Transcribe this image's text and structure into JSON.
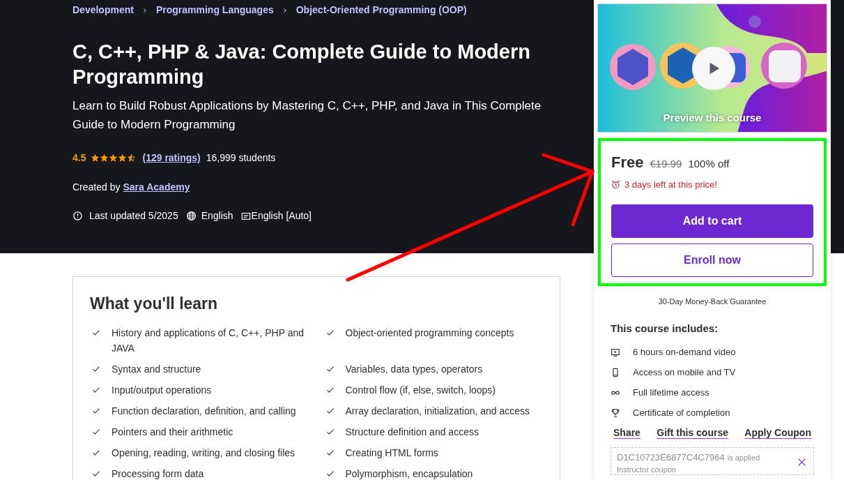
{
  "breadcrumbs": [
    "Development",
    "Programming Languages",
    "Object-Oriented Programming (OOP)"
  ],
  "title": "C, C++, PHP & Java: Complete Guide to Modern Programming",
  "subtitle": "Learn to Build Robust Applications by Mastering C, C++, PHP, and Java in This Complete Guide to Modern Programming",
  "rating": {
    "value": "4.5",
    "stars": 4.5,
    "ratings": "(129 ratings)",
    "students": "16,999 students"
  },
  "created_by": {
    "label": "Created by",
    "author": "Sara Academy"
  },
  "meta": {
    "updated": "Last updated 5/2025",
    "language": "English",
    "captions": "English [Auto]"
  },
  "learn": {
    "heading": "What you'll learn",
    "items": [
      {
        "text": "History and applications of C, C++, PHP and JAVA"
      },
      {
        "text": "Object-oriented programming concepts"
      },
      {
        "text": "Syntax and structure"
      },
      {
        "text": "Variables, data types, operators"
      },
      {
        "text": "Input/output operations"
      },
      {
        "text": "Control flow (if, else, switch, loops)"
      },
      {
        "text": "Function declaration, definition, and calling"
      },
      {
        "text": "Array declaration, initialization, and access"
      },
      {
        "text": "Pointers and their arithmetic"
      },
      {
        "text": "Structure definition and access"
      },
      {
        "text": "Opening, reading, writing, and closing files"
      },
      {
        "text": "Creating HTML forms"
      },
      {
        "text": "Processing form data"
      },
      {
        "text": "Polymorphism, encapsulation"
      }
    ]
  },
  "sidebar": {
    "preview": {
      "kind": "picture",
      "label": "Preview this course"
    },
    "price": "Free",
    "original_price": "€19.99",
    "discount": "100% off",
    "deadline": "3 days left at this price!",
    "buttons": [
      "Add to cart",
      "Enroll now"
    ],
    "guarantee": "30-Day Money-Back Guarantee",
    "includes_heading": "This course includes:",
    "includes": [
      {
        "kind": "video",
        "text": "6 hours on-demand video"
      },
      {
        "kind": "mobile",
        "text": "Access on mobile and TV"
      },
      {
        "kind": "infinity",
        "text": "Full lifetime access"
      },
      {
        "kind": "trophy",
        "text": "Certificate of completion"
      }
    ],
    "links": [
      "Share",
      "Gift this course",
      "Apply Coupon"
    ],
    "coupon": {
      "code": "D1C10723E6877C4C7964",
      "status": "is applied",
      "note": "Instructor coupon"
    }
  }
}
